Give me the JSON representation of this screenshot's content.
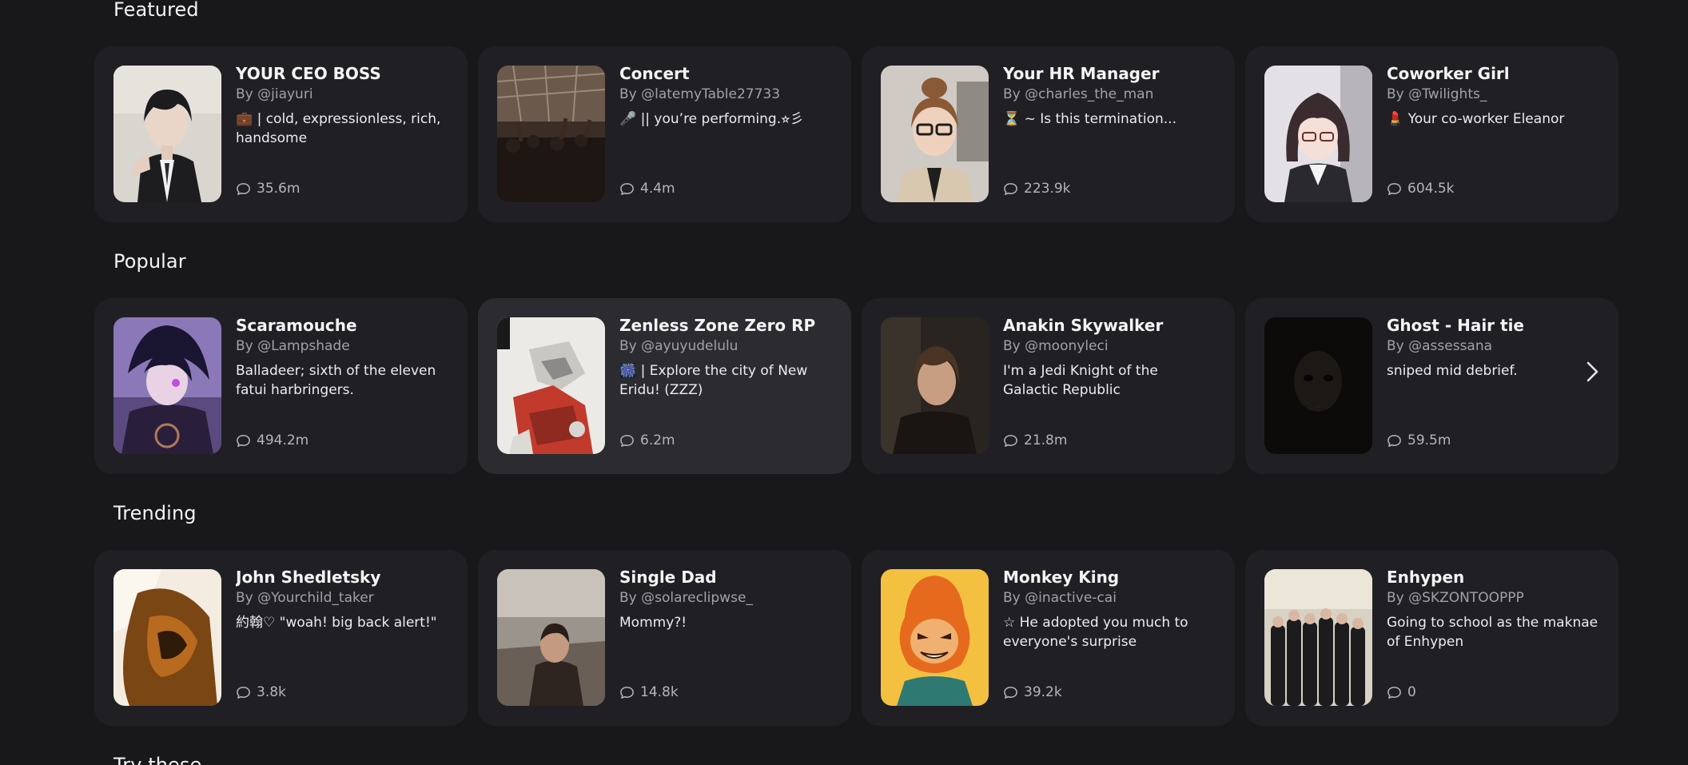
{
  "sections": {
    "featured": {
      "title": "Featured",
      "cards": [
        {
          "name": "YOUR CEO BOSS",
          "author": "By @jiayuri",
          "description": "💼 | cold, expressionless, rich, handsome",
          "chats": "35.6m"
        },
        {
          "name": "Concert",
          "author": "By @latemyTable27733",
          "description": "🎤 || you’re performing.⭐︎彡",
          "chats": "4.4m"
        },
        {
          "name": "Your HR Manager",
          "author": "By @charles_the_man",
          "description": "⏳ ~ Is this termination...",
          "chats": "223.9k"
        },
        {
          "name": "Coworker Girl",
          "author": "By @Twilights_",
          "description": "💄 Your co-worker Eleanor",
          "chats": "604.5k"
        }
      ]
    },
    "popular": {
      "title": "Popular",
      "cards": [
        {
          "name": "Scaramouche",
          "author": "By @Lampshade",
          "description": "Balladeer; sixth of the eleven fatui harbringers.",
          "chats": "494.2m"
        },
        {
          "name": "Zenless Zone Zero RP",
          "author": "By @ayuyudelulu",
          "description": "🎆 | Explore the city of New Eridu! (ZZZ)",
          "chats": "6.2m"
        },
        {
          "name": "Anakin Skywalker",
          "author": "By @moonyleci",
          "description": "I'm a Jedi Knight of the Galactic Republic",
          "chats": "21.8m"
        },
        {
          "name": "Ghost - Hair tie",
          "author": "By @assessana",
          "description": "sniped mid debrief.",
          "chats": "59.5m"
        }
      ]
    },
    "trending": {
      "title": "Trending",
      "cards": [
        {
          "name": "John Shedletsky",
          "author": "By @Yourchild_taker",
          "description": "約翰♡ \"woah! big back alert!\"",
          "chats": "3.8k"
        },
        {
          "name": "Single Dad",
          "author": "By @solareclipwse_",
          "description": "Mommy?!",
          "chats": "14.8k"
        },
        {
          "name": "Monkey King",
          "author": "By @inactive-cai",
          "description": "☆ He adopted you much to everyone's surprise",
          "chats": "39.2k"
        },
        {
          "name": "Enhypen",
          "author": "By @SKZONTOOPPP",
          "description": "Going to school as the maknae of Enhypen",
          "chats": "0"
        }
      ]
    },
    "try_these": {
      "title": "Try these"
    }
  },
  "icons": {
    "chat": "speech-bubble-icon",
    "next": "chevron-right-icon"
  },
  "colors": {
    "background": "#18181b",
    "card": "#202024",
    "card_hover": "#2b2b30",
    "muted_text": "#a1a1aa"
  }
}
